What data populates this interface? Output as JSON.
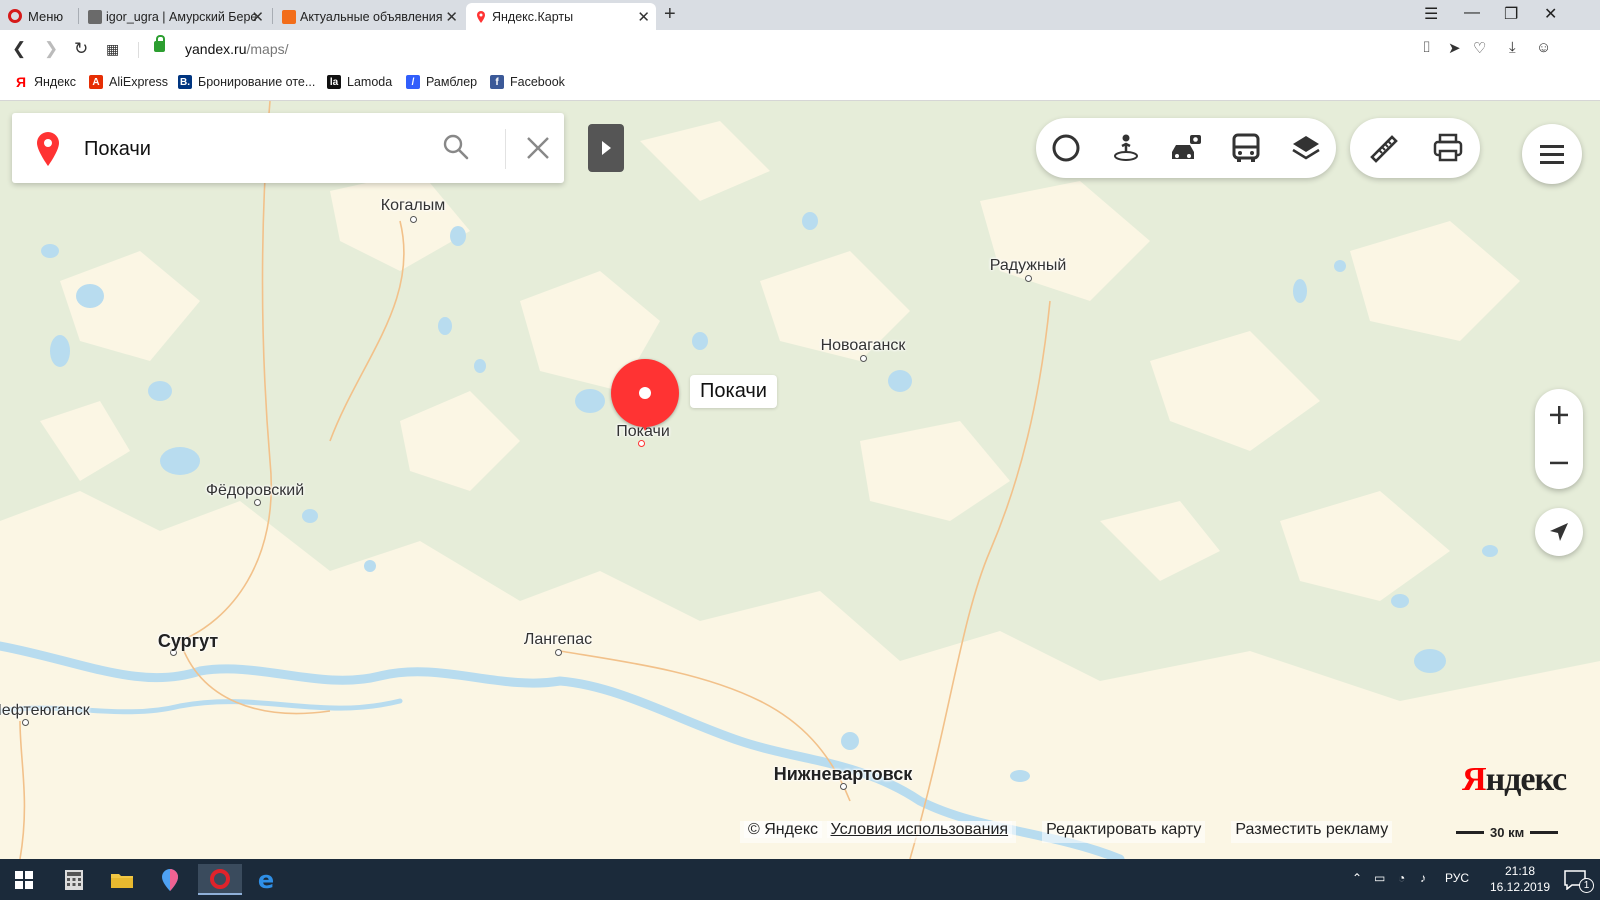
{
  "browser": {
    "menu_label": "Меню",
    "tabs": [
      {
        "title": "igor_ugra | Амурский Берег",
        "fav_color": "#6a6a6a"
      },
      {
        "title": "Актуальные объявления",
        "fav_color": "#f26d1a"
      },
      {
        "title": "Яндекс.Карты",
        "fav_color": "#ff3333"
      }
    ],
    "url_host": "yandex.ru",
    "url_path": "/maps/",
    "bookmarks": [
      {
        "label": "Яндекс",
        "icon_text": "Я",
        "color": "#ff0000"
      },
      {
        "label": "AliExpress",
        "icon_text": "A",
        "color": "#e62e04"
      },
      {
        "label": "Бронирование оте...",
        "icon_text": "B.",
        "color": "#003580"
      },
      {
        "label": "Lamoda",
        "icon_text": "la",
        "color": "#111111"
      },
      {
        "label": "Рамблер",
        "icon_text": "/",
        "color": "#315efb"
      },
      {
        "label": "Facebook",
        "icon_text": "f",
        "color": "#3b5998"
      }
    ]
  },
  "search": {
    "value": "Покачи"
  },
  "map": {
    "selected_label": "Покачи",
    "cities": [
      {
        "name": "Когалым",
        "big": false
      },
      {
        "name": "Радужный",
        "big": false
      },
      {
        "name": "Новоаганск",
        "big": false
      },
      {
        "name": "Покачи",
        "big": false
      },
      {
        "name": "Фёдоровский",
        "big": false
      },
      {
        "name": "Сургут",
        "big": true
      },
      {
        "name": "Лангепас",
        "big": false
      },
      {
        "name": "Нефтеюганск",
        "big": false
      },
      {
        "name": "Нижневартовск",
        "big": true
      }
    ],
    "colors": {
      "land": "#e6edd9",
      "open_land": "#fbf6e4",
      "water": "#b8dcef",
      "road": "#f2c18a",
      "pin": "#ff3333"
    }
  },
  "footer": {
    "copyright": "© Яндекс",
    "terms": "Условия использования",
    "edit": "Редактировать карту",
    "ads": "Разместить рекламу",
    "scale": "30 км"
  },
  "logo": {
    "first": "Я",
    "rest": "ндекс"
  },
  "taskbar": {
    "lang": "РУС",
    "time": "21:18",
    "date": "16.12.2019",
    "notifications": "1"
  }
}
